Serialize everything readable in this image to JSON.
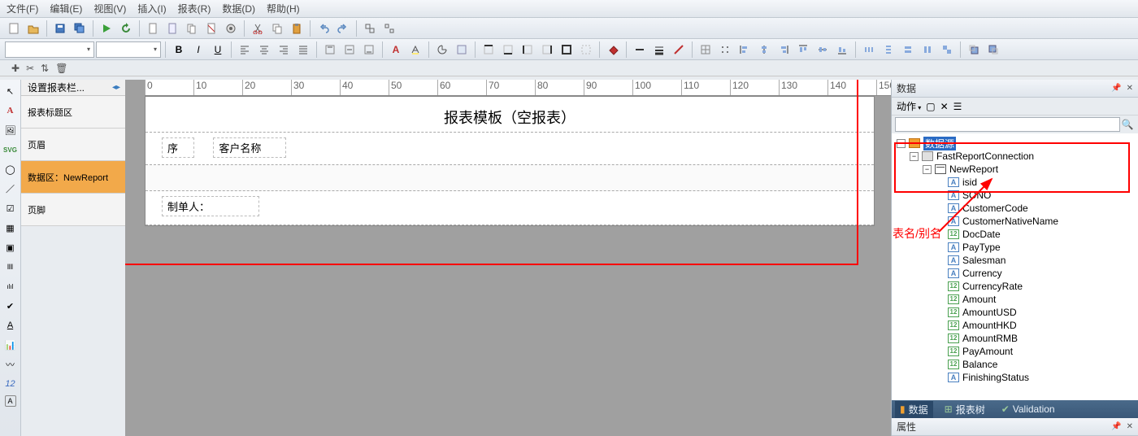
{
  "menu": [
    "文件(F)",
    "编辑(E)",
    "视图(V)",
    "插入(I)",
    "报表(R)",
    "数据(D)",
    "帮助(H)"
  ],
  "bands": {
    "header_label": "设置报表栏...",
    "items": [
      "报表标题区",
      "页眉",
      "数据区：NewReport",
      "页脚"
    ],
    "selected_index": 2
  },
  "design": {
    "title": "报表模板（空报表）",
    "header_fields": [
      "序",
      "客户名称"
    ],
    "footer_field": "制单人："
  },
  "right": {
    "panel_title": "数据",
    "actions_label": "动作",
    "tree_root": "数据源",
    "connection": "FastReportConnection",
    "table": "NewReport",
    "fields": [
      {
        "type": "A",
        "name": "isid"
      },
      {
        "type": "A",
        "name": "SONO"
      },
      {
        "type": "A",
        "name": "CustomerCode"
      },
      {
        "type": "A",
        "name": "CustomerNativeName"
      },
      {
        "type": "12",
        "name": "DocDate"
      },
      {
        "type": "A",
        "name": "PayType"
      },
      {
        "type": "A",
        "name": "Salesman"
      },
      {
        "type": "A",
        "name": "Currency"
      },
      {
        "type": "12",
        "name": "CurrencyRate"
      },
      {
        "type": "12",
        "name": "Amount"
      },
      {
        "type": "12",
        "name": "AmountUSD"
      },
      {
        "type": "12",
        "name": "AmountHKD"
      },
      {
        "type": "12",
        "name": "AmountRMB"
      },
      {
        "type": "12",
        "name": "PayAmount"
      },
      {
        "type": "12",
        "name": "Balance"
      },
      {
        "type": "A",
        "name": "FinishingStatus"
      }
    ],
    "tabs": [
      "数据",
      "报表树",
      "Validation"
    ],
    "properties_title": "属性"
  },
  "annotation": "表名/别名",
  "icons": {
    "new": "#6fa8dc",
    "open": "#e6b85c",
    "save": "#4a7cbf",
    "play": "#3aa03a",
    "cut": "#888",
    "copy": "#888",
    "paste": "#e0a040",
    "undo": "#5a88c0",
    "redo": "#5a88c0",
    "bold": "B",
    "italic": "I",
    "underline": "U"
  }
}
